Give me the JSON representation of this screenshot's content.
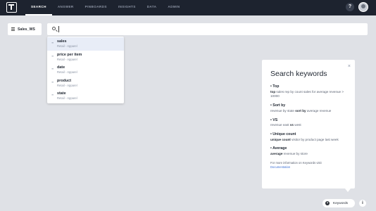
{
  "nav": {
    "items": [
      "SEARCH",
      "ANSWER",
      "PINBOARDS",
      "INSIGHTS",
      "DATA",
      "ADMIN"
    ],
    "active_index": 0,
    "help_label": "?"
  },
  "source": {
    "label": "Sales_WS"
  },
  "search": {
    "value": "",
    "placeholder": ""
  },
  "dropdown": {
    "items": [
      {
        "label": "sales",
        "sub": "Retail - Apparel",
        "icon": "column-icon"
      },
      {
        "label": "price per item",
        "sub": "Retail - Apparel",
        "icon": "column-icon"
      },
      {
        "label": "date",
        "sub": "Retail - Apparel",
        "icon": "column-icon"
      },
      {
        "label": "product",
        "sub": "Retail - Apparel",
        "icon": "column-icon"
      },
      {
        "label": "state",
        "sub": "Retail - Apparel",
        "icon": "column-icon"
      }
    ]
  },
  "keywords_panel": {
    "title": "Search keywords",
    "close_label": "×",
    "sections": [
      {
        "head": "• Top",
        "pre": "",
        "kw": "top",
        "post": " sales rep by count sales for average revenue > 10000"
      },
      {
        "head": "• Sort by",
        "pre": "revenue by state ",
        "kw": "sort by",
        "post": " average revenue"
      },
      {
        "head": "• VS",
        "pre": "revenue east ",
        "kw": "vs",
        "post": " west"
      },
      {
        "head": "• Unique count",
        "pre": "",
        "kw": "unique count",
        "post": " visitor by product page last week"
      },
      {
        "head": "• Average",
        "pre": "",
        "kw": "average",
        "post": " revenue by store"
      }
    ],
    "footer_text": "For more information on Keywords visit",
    "footer_link": "Documentation"
  },
  "bottom": {
    "keywords_button": "Keywords",
    "info_label": "i"
  }
}
